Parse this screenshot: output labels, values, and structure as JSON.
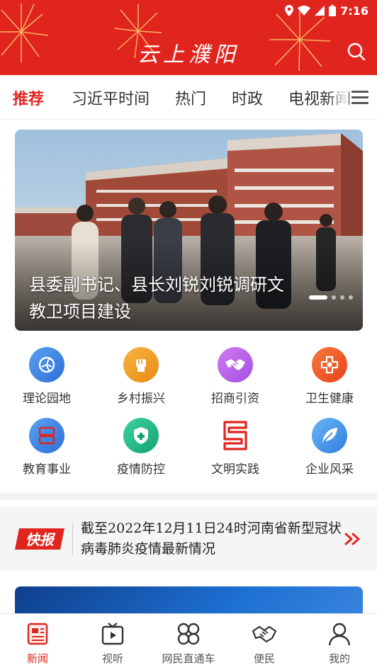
{
  "status_bar": {
    "time": "7:16"
  },
  "header": {
    "logo_text": "云上濮阳"
  },
  "tabs": [
    {
      "label": "推荐",
      "active": true
    },
    {
      "label": "习近平时间"
    },
    {
      "label": "热门"
    },
    {
      "label": "时政"
    },
    {
      "label": "电视新闻"
    }
  ],
  "banner": {
    "title": "县委副书记、县长刘锐刘锐调研文教卫项目建设",
    "slide_count": 5,
    "active_slide": 1
  },
  "shortcuts": [
    {
      "label": "理论园地",
      "icon": "globe-icon",
      "color": "#3a82e8"
    },
    {
      "label": "乡村振兴",
      "icon": "fist-icon",
      "color": "#f19a22"
    },
    {
      "label": "招商引资",
      "icon": "handshake-icon",
      "color": "#b55ce6"
    },
    {
      "label": "卫生健康",
      "icon": "medical-cross-icon",
      "color": "#ef5a22"
    },
    {
      "label": "教育事业",
      "icon": "education-icon",
      "color": "#3a82e8"
    },
    {
      "label": "疫情防控",
      "icon": "shield-icon",
      "color": "#20b784"
    },
    {
      "label": "文明实践",
      "icon": "civilization-icon",
      "color": "#e0251f"
    },
    {
      "label": "企业风采",
      "icon": "leaf-icon",
      "color": "#3a8ee8"
    }
  ],
  "flash": {
    "badge": "快报",
    "text": "截至2022年12月11日24时河南省新型冠状病毒肺炎疫情最新情况"
  },
  "bottom_nav": [
    {
      "label": "新闻",
      "icon": "news-icon",
      "active": true
    },
    {
      "label": "视听",
      "icon": "video-icon"
    },
    {
      "label": "网民直通车",
      "icon": "grid-icon"
    },
    {
      "label": "便民",
      "icon": "handshake-icon"
    },
    {
      "label": "我的",
      "icon": "user-icon"
    }
  ],
  "colors": {
    "brand": "#e0251f"
  }
}
